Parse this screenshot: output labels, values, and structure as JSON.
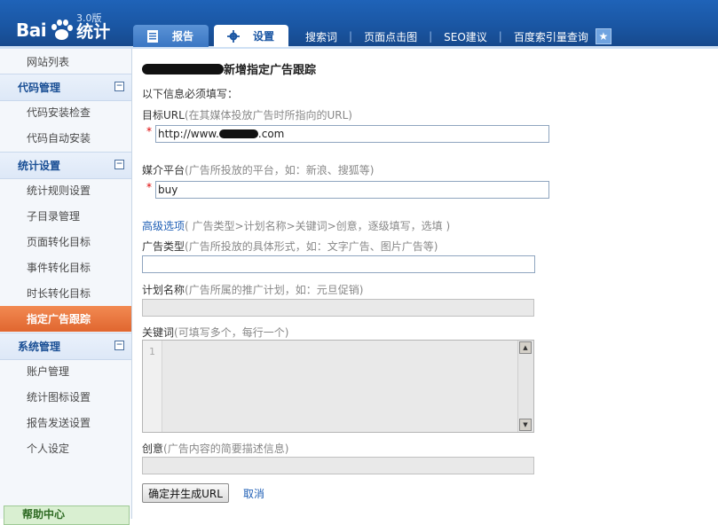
{
  "header": {
    "logo_text": "Bai",
    "logo_stat": "统计",
    "version": "3.0版",
    "tabs": [
      {
        "label": "报告"
      },
      {
        "label": "设置"
      }
    ],
    "nav": [
      "搜索词",
      "页面点击图",
      "SEO建议",
      "百度索引量查询"
    ]
  },
  "sidebar": {
    "top_item": "网站列表",
    "groups": [
      {
        "title": "代码管理",
        "toggle": "⊟",
        "items": [
          "代码安装检查",
          "代码自动安装"
        ]
      },
      {
        "title": "统计设置",
        "toggle": "⊟",
        "items": [
          "统计规则设置",
          "子目录管理",
          "页面转化目标",
          "事件转化目标",
          "时长转化目标",
          "指定广告跟踪"
        ]
      },
      {
        "title": "系统管理",
        "toggle": "⊟",
        "items": [
          "账户管理",
          "统计图标设置",
          "报告发送设置",
          "个人设定"
        ]
      }
    ],
    "active_item": "指定广告跟踪",
    "help_title": "帮助中心"
  },
  "main": {
    "title_suffix": "新增指定广告跟踪",
    "required_note": "以下信息必须填写：",
    "url_label": "目标URL",
    "url_hint": "(在其媒体投放广告时所指向的URL)",
    "url_value_prefix": "http://www.",
    "url_value_suffix": ".com",
    "required_mark": "*",
    "media_label": "媒介平台",
    "media_hint": "(广告所投放的平台，如：新浪、搜狐等)",
    "media_value": "buy",
    "advanced_link": "高级选项",
    "advanced_hint": "( 广告类型>计划名称>关键词>创意，逐级填写，选填 )",
    "adtype_label": "广告类型",
    "adtype_hint": "(广告所投放的具体形式，如：文字广告、图片广告等)",
    "plan_label": "计划名称",
    "plan_hint": "(广告所属的推广计划，如：元旦促销)",
    "keyword_label": "关键词",
    "keyword_hint": "(可填写多个，每行一个)",
    "line_number": "1",
    "creative_label": "创意",
    "creative_hint": "(广告内容的简要描述信息)",
    "submit_label": "确定并生成URL",
    "cancel_label": "取消"
  }
}
